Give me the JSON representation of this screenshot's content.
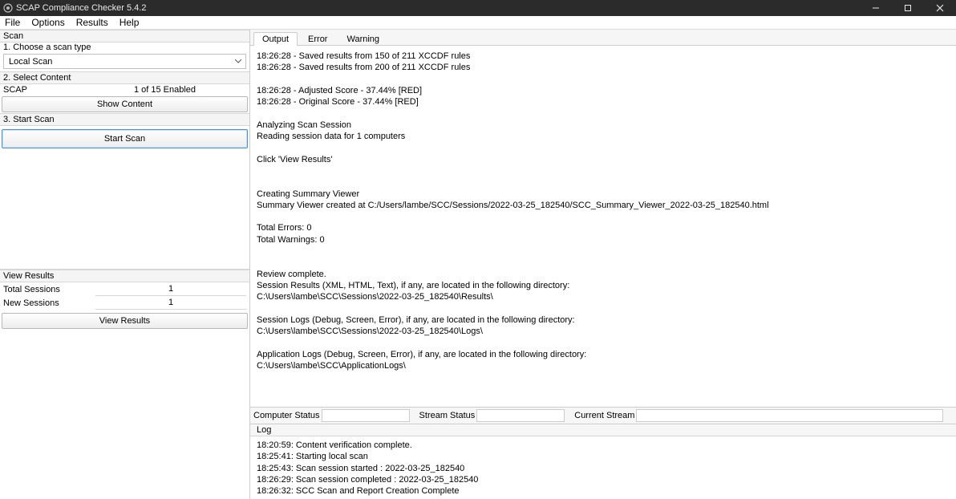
{
  "window": {
    "title": "SCAP Compliance Checker 5.4.2"
  },
  "menu": {
    "file": "File",
    "options": "Options",
    "results": "Results",
    "help": "Help"
  },
  "left": {
    "scan_header": "Scan",
    "step1": "1.  Choose a scan type",
    "scan_type_value": "Local Scan",
    "step2": "2.  Select Content",
    "content_row_label": "SCAP",
    "content_row_value": "1 of 15 Enabled",
    "show_content_btn": "Show Content",
    "step3": "3.  Start Scan",
    "start_scan_btn": "Start Scan",
    "view_results_header": "View Results",
    "total_sessions_label": "Total Sessions",
    "total_sessions_value": "1",
    "new_sessions_label": "New Sessions",
    "new_sessions_value": "1",
    "view_results_btn": "View Results"
  },
  "tabs": {
    "output": "Output",
    "error": "Error",
    "warning": "Warning"
  },
  "output_text": "18:26:28 - Saved results from 150 of 211 XCCDF rules\n18:26:28 - Saved results from 200 of 211 XCCDF rules\n\n18:26:28 - Adjusted Score - 37.44% [RED]\n18:26:28 - Original Score - 37.44% [RED]\n\nAnalyzing Scan Session\nReading session data for 1 computers\n\nClick 'View Results'\n\n\nCreating Summary Viewer\nSummary Viewer created at C:/Users/lambe/SCC/Sessions/2022-03-25_182540/SCC_Summary_Viewer_2022-03-25_182540.html\n\nTotal Errors: 0\nTotal Warnings: 0\n\n\nReview complete.\nSession Results (XML, HTML, Text), if any, are located in the following directory:\nC:\\Users\\lambe\\SCC\\Sessions\\2022-03-25_182540\\Results\\\n\nSession Logs (Debug, Screen, Error), if any, are located in the following directory:\nC:\\Users\\lambe\\SCC\\Sessions\\2022-03-25_182540\\Logs\\\n\nApplication Logs (Debug, Screen, Error), if any, are located in the following directory:\nC:\\Users\\lambe\\SCC\\ApplicationLogs\\",
  "status": {
    "computer_label": "Computer Status",
    "computer_value": "",
    "stream_label": "Stream Status",
    "stream_value": "",
    "current_label": "Current Stream",
    "current_value": ""
  },
  "log": {
    "header": "Log",
    "text": "18:20:59: Content verification complete.\n18:25:41: Starting local scan\n18:25:43: Scan session started : 2022-03-25_182540\n18:26:29: Scan session completed : 2022-03-25_182540\n18:26:32: SCC Scan and Report Creation Complete"
  }
}
